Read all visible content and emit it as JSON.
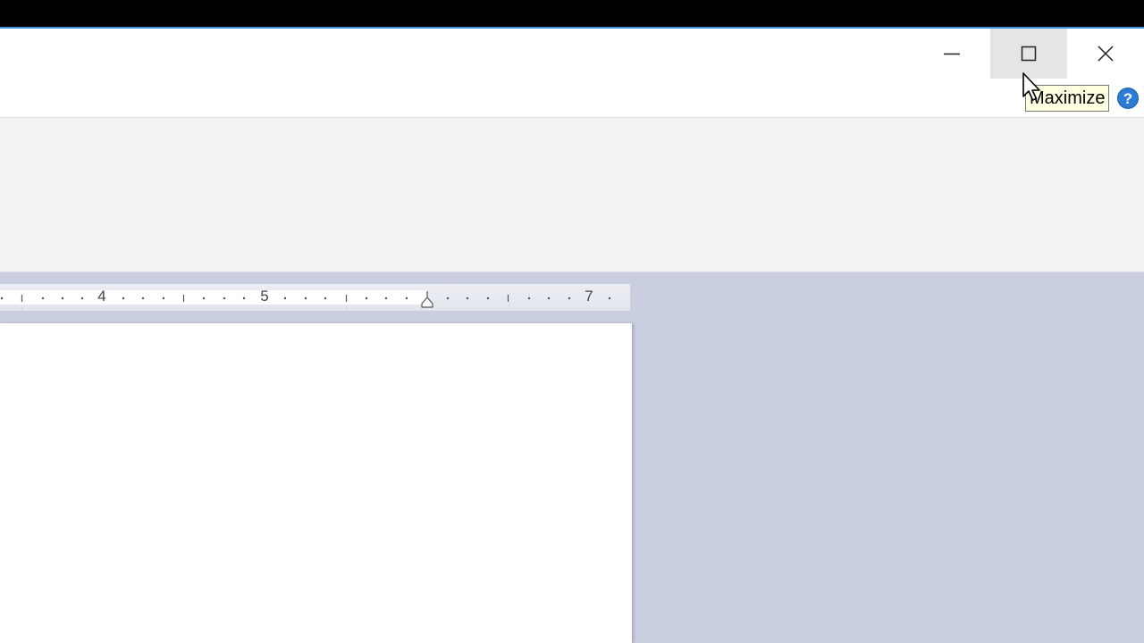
{
  "window": {
    "tooltip": "Maximize",
    "help_glyph": "?"
  },
  "ruler": {
    "labels": [
      "4",
      "5",
      "7"
    ]
  },
  "icons": {
    "minimize": "minimize-icon",
    "maximize": "maximize-icon",
    "close": "close-icon",
    "help": "help-icon",
    "cursor": "mouse-cursor-icon",
    "indent": "right-indent-marker-icon"
  },
  "colors": {
    "accent_border": "#3b8fd9",
    "tooltip_bg": "#ffffe1",
    "help_blue": "#2b7cd3",
    "workspace": "#c9cfe0",
    "ribbon": "#f3f3f3"
  }
}
